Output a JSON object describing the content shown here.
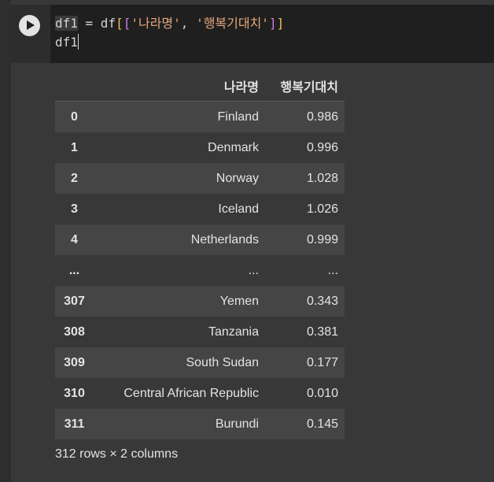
{
  "code": {
    "line1": {
      "var": "df1",
      "assign": " = df",
      "open_outer": "[",
      "open_inner": "[",
      "str1": "'나라명'",
      "sep": ", ",
      "str2": "'행복기대치'",
      "close_inner": "]",
      "close_outer": "]"
    },
    "line2": "df1"
  },
  "table": {
    "columns": [
      "나라명",
      "행복기대치"
    ],
    "rows": [
      {
        "index": "0",
        "name": "Finland",
        "value": "0.986"
      },
      {
        "index": "1",
        "name": "Denmark",
        "value": "0.996"
      },
      {
        "index": "2",
        "name": "Norway",
        "value": "1.028"
      },
      {
        "index": "3",
        "name": "Iceland",
        "value": "1.026"
      },
      {
        "index": "4",
        "name": "Netherlands",
        "value": "0.999"
      },
      {
        "index": "...",
        "name": "...",
        "value": "..."
      },
      {
        "index": "307",
        "name": "Yemen",
        "value": "0.343"
      },
      {
        "index": "308",
        "name": "Tanzania",
        "value": "0.381"
      },
      {
        "index": "309",
        "name": "South Sudan",
        "value": "0.177"
      },
      {
        "index": "310",
        "name": "Central African Republic",
        "value": "0.010"
      },
      {
        "index": "311",
        "name": "Burundi",
        "value": "0.145"
      }
    ],
    "footer": "312 rows × 2 columns"
  },
  "icons": {
    "run": "play-icon"
  }
}
